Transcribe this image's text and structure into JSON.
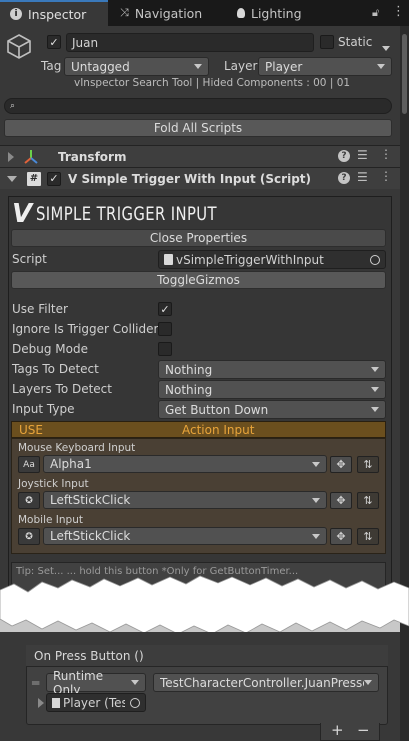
{
  "tabs": [
    {
      "label": "Inspector",
      "icon": "info-icon"
    },
    {
      "label": "Navigation",
      "icon": "navigation-icon"
    },
    {
      "label": "Lighting",
      "icon": "lightbulb-icon"
    }
  ],
  "object": {
    "name": "Juan",
    "active": true,
    "static_label": "Static",
    "tag_label": "Tag",
    "tag_value": "Untagged",
    "layer_label": "Layer",
    "layer_value": "Player",
    "info_line": "vInspector Search Tool | Hided Components : 00 | 01"
  },
  "search": {
    "placeholder": ""
  },
  "fold_all_label": "Fold All Scripts",
  "components": {
    "transform": {
      "title": "Transform"
    },
    "trigger": {
      "title": "V Simple Trigger With Input (Script)",
      "enabled": true
    }
  },
  "trigger": {
    "banner": "SIMPLE TRIGGER INPUT",
    "banner_mark": "V",
    "close_properties": "Close Properties",
    "script_label": "Script",
    "script_value": "vSimpleTriggerWithInput",
    "toggle_gizmos": "ToggleGizmos",
    "use_filter_label": "Use Filter",
    "use_filter": true,
    "ignore_trigger_label": "Ignore Is Trigger Colliders",
    "ignore_trigger": false,
    "debug_mode_label": "Debug Mode",
    "debug_mode": false,
    "tags_label": "Tags To Detect",
    "tags_value": "Nothing",
    "layers_label": "Layers To Detect",
    "layers_value": "Nothing",
    "input_type_label": "Input Type",
    "input_type_value": "Get Button Down",
    "use_label": "USE",
    "action_input_label": "Action Input",
    "inputs": [
      {
        "label": "Mouse Keyboard Input",
        "icon_text": "Aa",
        "value": "Alpha1"
      },
      {
        "label": "Joystick Input",
        "icon_text": "",
        "value": "LeftStickClick"
      },
      {
        "label": "Mobile Input",
        "icon_text": "",
        "value": "LeftStickClick"
      }
    ],
    "tip_text": "Tip: Set... ... hold this button *Only for GetButtonTimer..."
  },
  "event": {
    "title": "On Press Button ()",
    "runtime_value": "Runtime Only",
    "function_value": "TestCharacterController.JuanPressec",
    "target_value": "Player (Test",
    "add_label": "+",
    "remove_label": "−"
  },
  "colors": {
    "accent": "#3a79bb",
    "panel": "#383838",
    "use_header": "#6b4f1e",
    "action_text": "#e0a030"
  }
}
